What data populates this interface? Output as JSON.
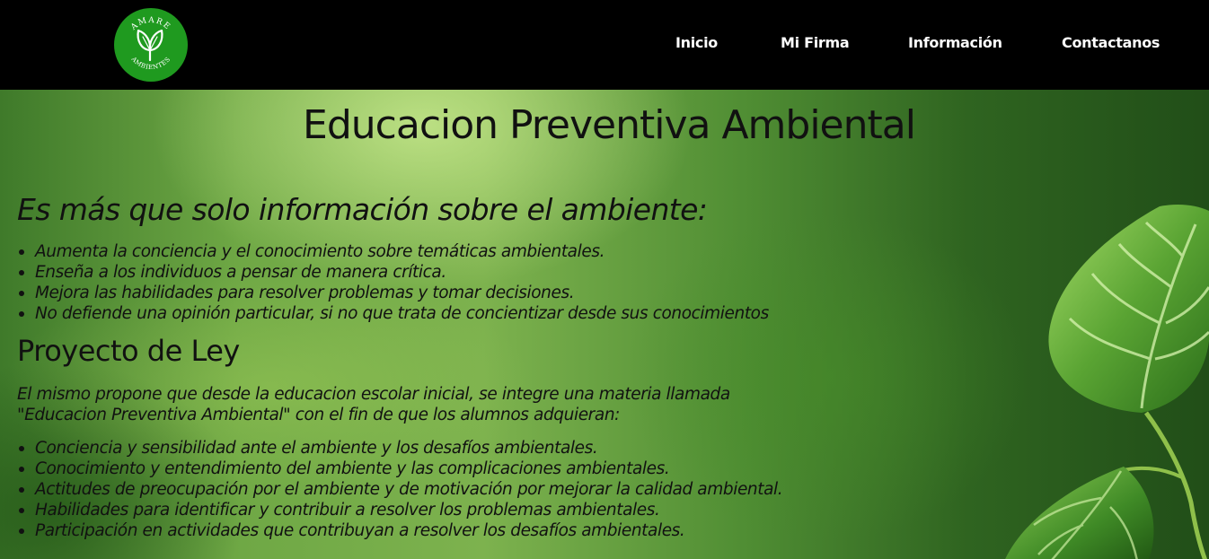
{
  "logo": {
    "text_top": "AMARE",
    "text_bottom": "AMBIENTES",
    "icon": "leaf-icon"
  },
  "nav": {
    "items": [
      {
        "label": "Inicio"
      },
      {
        "label": "Mi Firma"
      },
      {
        "label": "Información"
      },
      {
        "label": "Contactanos"
      }
    ]
  },
  "main": {
    "title": "Educacion Preventiva Ambiental",
    "subtitle": "Es más que solo información sobre el ambiente:",
    "list1": [
      "Aumenta la conciencia y el conocimiento sobre temáticas ambientales.",
      "Enseña a los individuos a pensar de manera crítica.",
      "Mejora las habilidades para resolver problemas y tomar decisiones.",
      "No defiende una opinión particular, si no que trata de concientizar desde sus conocimientos"
    ],
    "section_title": "Proyecto de Ley",
    "paragraph_line1": "El mismo propone que desde la educacion escolar inicial, se integre una materia llamada",
    "paragraph_line2": "\"Educacion Preventiva Ambiental\" con el fin de que los alumnos adquieran:",
    "list2": [
      "Conciencia y sensibilidad ante el ambiente y los desafíos ambientales.",
      "Conocimiento y entendimiento del ambiente y las complicaciones ambientales.",
      "Actitudes de preocupación por el ambiente y de motivación por mejorar la calidad ambiental.",
      "Habilidades para identificar y contribuir a resolver los problemas ambientales.",
      "Participación en actividades que contribuyan a resolver los desafíos ambientales."
    ]
  },
  "colors": {
    "navbar": "#000000",
    "logo_bg": "#1f9a1f",
    "nav_text": "#ffffff",
    "text": "#111111"
  }
}
